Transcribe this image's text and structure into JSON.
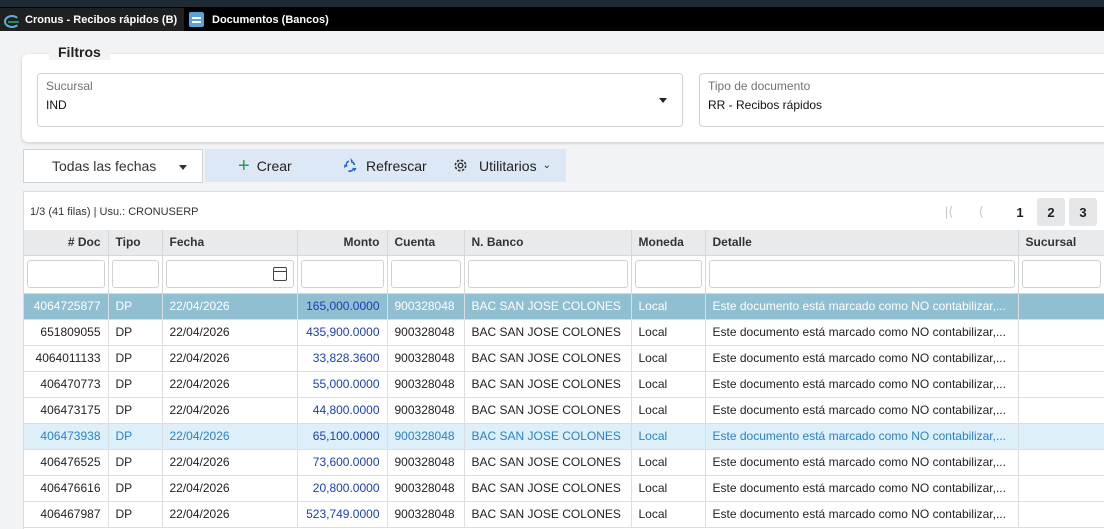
{
  "tabs": [
    {
      "label": "Cronus - Recibos rápidos (B)",
      "icon": "cronus-logo-icon"
    },
    {
      "label": "Documentos (Bancos)",
      "icon": "document-icon"
    }
  ],
  "filters": {
    "title": "Filtros",
    "sucursal": {
      "label": "Sucursal",
      "value": "IND"
    },
    "tipo_documento": {
      "label": "Tipo de documento",
      "value": "RR - Recibos rápidos"
    }
  },
  "toolbar": {
    "date_filter": "Todas las fechas",
    "crear": "Crear",
    "refrescar": "Refrescar",
    "utilitarios": "Utilitarios"
  },
  "grid": {
    "info": "1/3 (41 filas) | Usu.: CRONUSERP",
    "pages": [
      "1",
      "2",
      "3"
    ],
    "columns": [
      "# Doc",
      "Tipo",
      "Fecha",
      "Monto",
      "Cuenta",
      "N. Banco",
      "Moneda",
      "Detalle",
      "Sucursal"
    ],
    "rows": [
      {
        "doc": "4064725877",
        "tipo": "DP",
        "fecha": "22/04/2026",
        "monto": "165,000.0000",
        "cuenta": "900328048",
        "banco": "BAC SAN JOSE COLONES",
        "moneda": "Local",
        "detalle": "Este documento está marcado como NO contabilizar,..."
      },
      {
        "doc": "651809055",
        "tipo": "DP",
        "fecha": "22/04/2026",
        "monto": "435,900.0000",
        "cuenta": "900328048",
        "banco": "BAC SAN JOSE COLONES",
        "moneda": "Local",
        "detalle": "Este documento está marcado como NO contabilizar,..."
      },
      {
        "doc": "4064011133",
        "tipo": "DP",
        "fecha": "22/04/2026",
        "monto": "33,828.3600",
        "cuenta": "900328048",
        "banco": "BAC SAN JOSE COLONES",
        "moneda": "Local",
        "detalle": "Este documento está marcado como NO contabilizar,..."
      },
      {
        "doc": "406470773",
        "tipo": "DP",
        "fecha": "22/04/2026",
        "monto": "55,000.0000",
        "cuenta": "900328048",
        "banco": "BAC SAN JOSE COLONES",
        "moneda": "Local",
        "detalle": "Este documento está marcado como NO contabilizar,..."
      },
      {
        "doc": "406473175",
        "tipo": "DP",
        "fecha": "22/04/2026",
        "monto": "44,800.0000",
        "cuenta": "900328048",
        "banco": "BAC SAN JOSE COLONES",
        "moneda": "Local",
        "detalle": "Este documento está marcado como NO contabilizar,..."
      },
      {
        "doc": "406473938",
        "tipo": "DP",
        "fecha": "22/04/2026",
        "monto": "65,100.0000",
        "cuenta": "900328048",
        "banco": "BAC SAN JOSE COLONES",
        "moneda": "Local",
        "detalle": "Este documento está marcado como NO contabilizar,..."
      },
      {
        "doc": "406476525",
        "tipo": "DP",
        "fecha": "22/04/2026",
        "monto": "73,600.0000",
        "cuenta": "900328048",
        "banco": "BAC SAN JOSE COLONES",
        "moneda": "Local",
        "detalle": "Este documento está marcado como NO contabilizar,..."
      },
      {
        "doc": "406476616",
        "tipo": "DP",
        "fecha": "22/04/2026",
        "monto": "20,800.0000",
        "cuenta": "900328048",
        "banco": "BAC SAN JOSE COLONES",
        "moneda": "Local",
        "detalle": "Este documento está marcado como NO contabilizar,..."
      },
      {
        "doc": "406467987",
        "tipo": "DP",
        "fecha": "22/04/2026",
        "monto": "523,749.0000",
        "cuenta": "900328048",
        "banco": "BAC SAN JOSE COLONES",
        "moneda": "Local",
        "detalle": "Este documento está marcado como NO contabilizar,..."
      }
    ]
  },
  "colors": {
    "selected_row": "#90bfd2",
    "highlight_row": "#ddeff8",
    "toolbar_bg": "#dce8f6",
    "amount_text": "#1a3fb0"
  }
}
